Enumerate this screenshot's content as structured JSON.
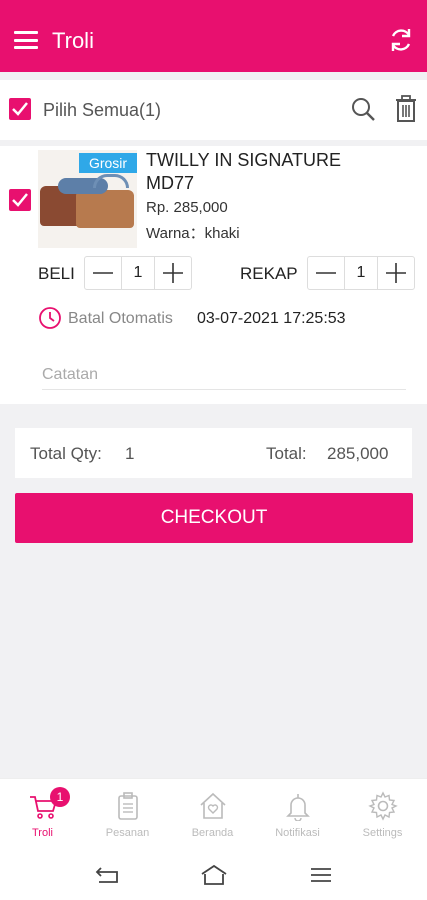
{
  "header": {
    "title": "Troli",
    "menu_icon": "hamburger-menu-icon",
    "refresh_icon": "refresh-icon"
  },
  "select_bar": {
    "label": "Pilih Semua(1)",
    "checked": true
  },
  "item": {
    "badge": "Grosir",
    "name": "TWILLY IN SIGNATURE MD77",
    "price": "Rp. 285,000",
    "color": "Warna：khaki",
    "beli_label": "BELI",
    "beli_qty": "1",
    "rekap_label": "REKAP",
    "rekap_qty": "1",
    "auto_cancel_label": "Batal Otomatis",
    "auto_cancel_time": "03-07-2021 17:25:53",
    "notes_placeholder": "Catatan",
    "checked": true
  },
  "totals": {
    "qty_label": "Total Qty:",
    "qty_value": "1",
    "total_label": "Total:",
    "total_value": "285,000"
  },
  "checkout_label": "CHECKOUT",
  "bottom_nav": [
    {
      "label": "Troli",
      "icon": "cart-icon",
      "active": true,
      "badge": "1"
    },
    {
      "label": "Pesanan",
      "icon": "clipboard-icon",
      "active": false
    },
    {
      "label": "Beranda",
      "icon": "home-heart-icon",
      "active": false
    },
    {
      "label": "Notifikasi",
      "icon": "bell-icon",
      "active": false
    },
    {
      "label": "Settings",
      "icon": "gear-icon",
      "active": false
    }
  ],
  "colors": {
    "brand": "#e8106f",
    "badge_blue": "#2fa8e8",
    "background": "#f1f1f3"
  }
}
